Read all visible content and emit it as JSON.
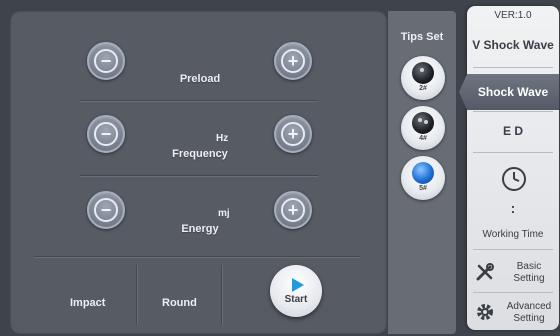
{
  "main": {
    "rows": [
      {
        "label": "Preload",
        "unit": ""
      },
      {
        "label": "Frequency",
        "unit": "Hz"
      },
      {
        "label": "Energy",
        "unit": "mj"
      }
    ],
    "minus_symbol": "−",
    "plus_symbol": "+",
    "bottom": {
      "impact_label": "Impact",
      "round_label": "Round",
      "start_label": "Start"
    }
  },
  "tips": {
    "title": "Tips Set",
    "items": [
      {
        "code": "2#",
        "selected": false
      },
      {
        "code": "4#",
        "selected": false
      },
      {
        "code": "5#",
        "selected": true
      }
    ]
  },
  "sidebar": {
    "version": "VER:1.0",
    "items": [
      {
        "label": "V Shock Wave"
      },
      {
        "label": "Shock Wave",
        "active": true
      },
      {
        "label": "E D"
      },
      {
        "label": "Working Time",
        "value_separator": ":"
      },
      {
        "label": "Basic Setting",
        "line1": "Basic",
        "line2": "Setting"
      },
      {
        "label": "Advanced Setting",
        "line1": "Advanced",
        "line2": "Setting"
      }
    ]
  },
  "colors": {
    "background": "#3f434b",
    "panel": "#575b64",
    "accent_blue": "#1e9be0",
    "sidebar_active": "#5e6571"
  },
  "icons": {
    "minus": "minus-icon",
    "plus": "plus-icon",
    "play": "play-icon",
    "clock": "clock-icon",
    "tools": "tools-icon",
    "gear": "gear-icon"
  }
}
